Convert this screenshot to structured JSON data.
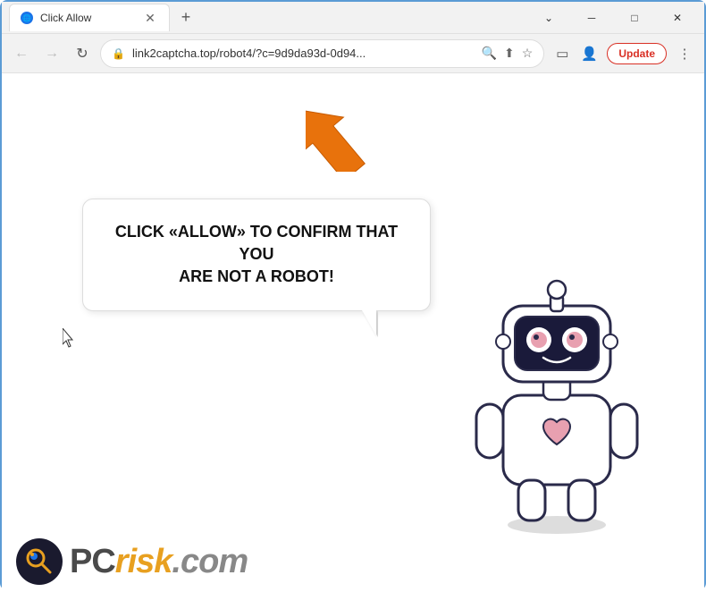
{
  "window": {
    "title": "Click Allow",
    "url": "link2captcha.top/robot4/?c=9d9da93d-0d94...",
    "url_full": "link2captcha.top/robot4/?c=9d9da93d-0d94..."
  },
  "browser": {
    "back_label": "←",
    "forward_label": "→",
    "refresh_label": "↻",
    "new_tab_label": "+",
    "minimize_label": "─",
    "maximize_label": "□",
    "close_label": "✕",
    "update_label": "Update",
    "menu_label": "⋮"
  },
  "page": {
    "bubble_text_line1": "CLICK «ALLOW» TO CONFIRM THAT YOU",
    "bubble_text_line2": "ARE NOT A ROBOT!"
  },
  "watermark": {
    "pc_text": "PC",
    "risk_text": "risk",
    "domain_text": ".com"
  }
}
